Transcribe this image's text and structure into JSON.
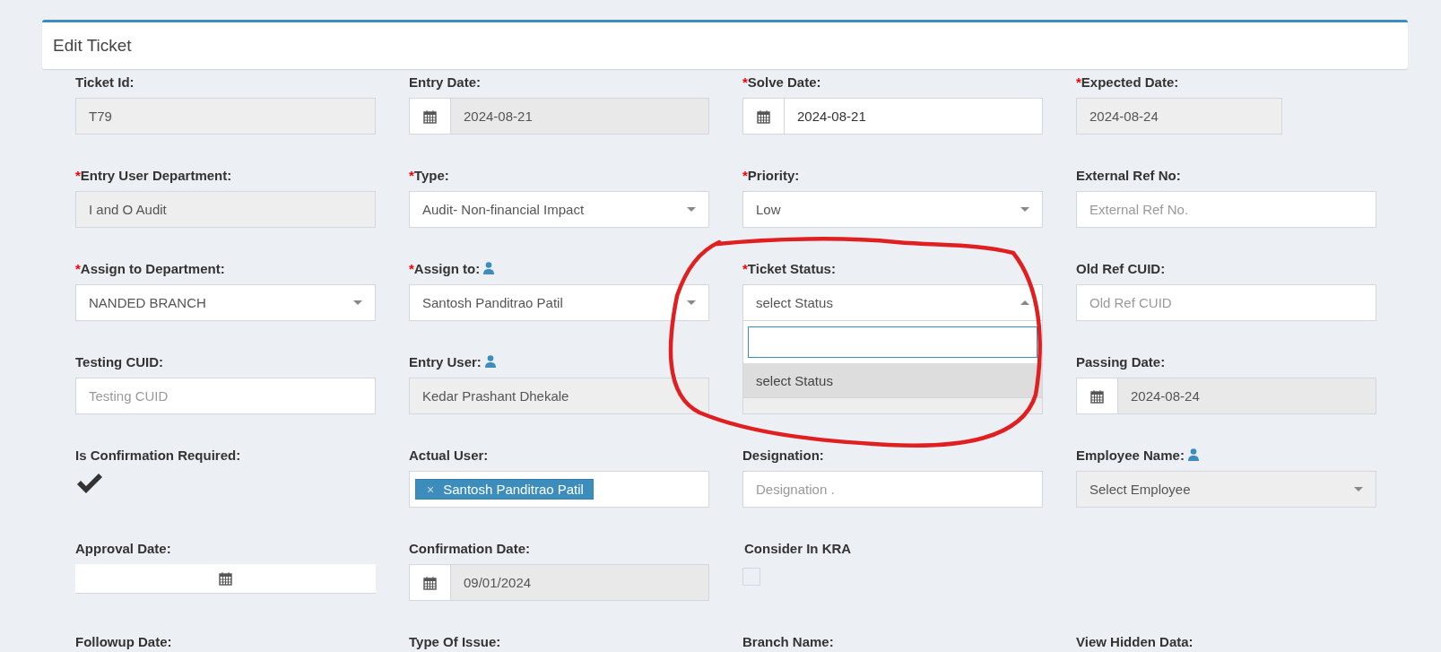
{
  "panel": {
    "title": "Edit Ticket"
  },
  "fields": [
    {
      "label": "Ticket Id:",
      "required": false,
      "user_icon": false,
      "kind": "input",
      "value": "T79",
      "disabled": true
    },
    {
      "label": "Entry Date:",
      "required": false,
      "user_icon": false,
      "kind": "date",
      "value": "2024-08-21",
      "disabled": true
    },
    {
      "label": "Solve Date:",
      "required": true,
      "user_icon": false,
      "kind": "date",
      "value": "2024-08-21",
      "disabled": false
    },
    {
      "label": "Expected Date:",
      "required": true,
      "user_icon": false,
      "kind": "short-input",
      "value": "2024-08-24",
      "disabled": true
    },
    {
      "label": "Entry User Department:",
      "required": true,
      "user_icon": false,
      "kind": "input",
      "value": "I and O Audit",
      "disabled": true
    },
    {
      "label": "Type:",
      "required": true,
      "user_icon": false,
      "kind": "select",
      "value": "Audit- Non-financial Impact",
      "disabled": false
    },
    {
      "label": "Priority:",
      "required": true,
      "user_icon": false,
      "kind": "select",
      "value": "Low",
      "disabled": false
    },
    {
      "label": "External Ref No:",
      "required": false,
      "user_icon": false,
      "kind": "input",
      "placeholder": "External Ref No.",
      "disabled": false
    },
    {
      "label": "Assign to Department:",
      "required": true,
      "user_icon": false,
      "kind": "select",
      "value": "NANDED BRANCH",
      "disabled": false
    },
    {
      "label": "Assign to:",
      "required": true,
      "user_icon": true,
      "kind": "select",
      "value": "Santosh Panditrao Patil",
      "disabled": false
    },
    {
      "label": "Ticket Status:",
      "required": true,
      "user_icon": false,
      "kind": "select",
      "value": "select Status",
      "disabled": false,
      "expanded": true,
      "options": [
        {
          "label": "select Status",
          "selected": true
        }
      ]
    },
    {
      "label": "Old Ref CUID:",
      "required": false,
      "user_icon": false,
      "kind": "input",
      "placeholder": "Old Ref CUID",
      "disabled": false
    },
    {
      "label": "Testing CUID:",
      "required": false,
      "user_icon": false,
      "kind": "input",
      "placeholder": "Testing CUID",
      "disabled": false
    },
    {
      "label": "Entry User:",
      "required": false,
      "user_icon": true,
      "kind": "input",
      "value": "Kedar Prashant Dhekale",
      "disabled": true
    },
    {
      "kind": "input",
      "disabled": true
    },
    {
      "label": "Passing Date:",
      "required": false,
      "user_icon": false,
      "kind": "date",
      "value": "2024-08-24",
      "disabled": true
    },
    {
      "label": "Is Confirmation Required:",
      "required": false,
      "user_icon": false,
      "kind": "tick",
      "checked": true
    },
    {
      "label": "Actual User:",
      "required": false,
      "user_icon": false,
      "kind": "tags",
      "tags": [
        {
          "remove": "×",
          "label": "Santosh Panditrao Patil"
        }
      ]
    },
    {
      "label": "Designation:",
      "required": false,
      "user_icon": false,
      "kind": "input",
      "placeholder": "Designation .",
      "disabled": false
    },
    {
      "label": "Employee Name:",
      "required": false,
      "user_icon": true,
      "kind": "select",
      "value": "Select Employee",
      "disabled": true
    },
    {
      "label": "Approval Date:",
      "required": false,
      "user_icon": false,
      "kind": "date-icon"
    },
    {
      "label": "Confirmation Date:",
      "required": false,
      "user_icon": false,
      "kind": "date",
      "value": "09/01/2024",
      "disabled": true
    },
    {
      "label": "Consider In KRA",
      "required": false,
      "user_icon": false,
      "kind": "checkbox",
      "checked": false
    },
    {
      "kind": "blank"
    },
    {
      "label": "Followup Date:",
      "required": false,
      "user_icon": false,
      "kind": "label"
    },
    {
      "label": "Type Of Issue:",
      "required": false,
      "user_icon": false,
      "kind": "label"
    },
    {
      "label": "Branch Name:",
      "required": false,
      "user_icon": false,
      "kind": "label"
    },
    {
      "label": "View Hidden Data:",
      "required": false,
      "user_icon": false,
      "kind": "label"
    }
  ],
  "required_marker": "*"
}
